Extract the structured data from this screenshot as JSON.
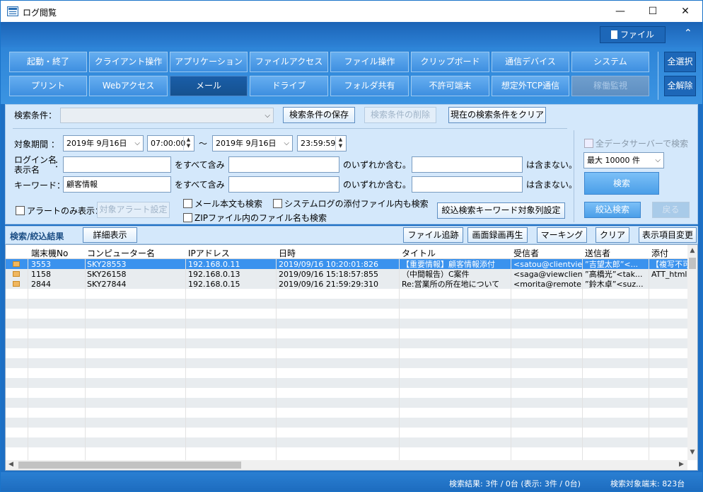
{
  "window": {
    "title": "ログ閲覧",
    "minimize": "—",
    "maximize": "☐",
    "close": "✕"
  },
  "topbar": {
    "file_label": "ファイル",
    "collapse": "⌃"
  },
  "categories_row1": [
    "起動・終了",
    "クライアント操作",
    "アプリケーション",
    "ファイルアクセス",
    "ファイル操作",
    "クリップボード",
    "通信デバイス",
    "システム"
  ],
  "categories_row2": [
    "プリント",
    "Webアクセス",
    "メール",
    "ドライブ",
    "フォルダ共有",
    "不許可端末",
    "想定外TCP通信",
    "稼働監視"
  ],
  "side": {
    "select_all": "全選択",
    "clear_all": "全解除"
  },
  "search": {
    "condition_label": "検索条件：",
    "save_btn": "検索条件の保存",
    "delete_btn": "検索条件の削除",
    "clear_btn": "現在の検索条件をクリア",
    "period_label": "対象期間 ：",
    "date_from": "2019年 9月16日",
    "time_from": "07:00:00",
    "tilde": "～",
    "date_to": "2019年 9月16日",
    "time_to": "23:59:59",
    "login_label_1": "ログイン名",
    "login_label_2": "表示名",
    "login_colon": "：",
    "contains_all": "をすべて含み",
    "contains_any": "のいずれか含む。",
    "not_contains": "は含まない。",
    "keyword_label": "キーワード：",
    "keyword_value": "顧客情報",
    "alert_only": "アラートのみ表示：",
    "alert_setting_btn": "対象アラート設定",
    "mail_body": "メール本文も検索",
    "syslog_attach": "システムログの添付ファイル内も検索",
    "zip_names": "ZIPファイル内のファイル名も検索",
    "refine_cols_btn": "絞込検索キーワード対象列設定",
    "all_servers": "全データサーバーで検索",
    "max_count": "最大 10000 件",
    "search_btn": "検索",
    "refine_btn": "絞込検索",
    "back_btn": "戻る"
  },
  "results": {
    "label": "検索/絞込結果",
    "detail_btn": "詳細表示",
    "file_trace_btn": "ファイル追跡",
    "screen_btn": "画面録画再生",
    "marking_btn": "マーキング",
    "clear_btn": "クリア",
    "columns_btn": "表示項目変更"
  },
  "table": {
    "headers": [
      "端末機No",
      "コンピューター名",
      "IPアドレス",
      "日時",
      "タイトル",
      "受信者",
      "送信者",
      "添付"
    ],
    "rows": [
      [
        "3553",
        "SKY28553",
        "192.168.0.11",
        "2019/09/16 10:20:01:826",
        "【重要情報】顧客情報添付",
        "<satou@clientvie...",
        "”吉望太郎”<...",
        "【複写不可"
      ],
      [
        "1158",
        "SKY26158",
        "192.168.0.13",
        "2019/09/16 15:18:57:855",
        "（中間報告）C案件",
        "<saga@viewclient...",
        "”高橋光”<tak...",
        "ATT_html"
      ],
      [
        "2844",
        "SKY27844",
        "192.168.0.15",
        "2019/09/16 21:59:29:310",
        "Re:営業所の所在地について",
        "<morita@remote...",
        "”鈴木卓”<suz...",
        ""
      ]
    ]
  },
  "status": {
    "result": "検索結果: 3件 / 0台 (表示: 3件 / 0台)",
    "terminals": "検索対象端末: 823台"
  }
}
